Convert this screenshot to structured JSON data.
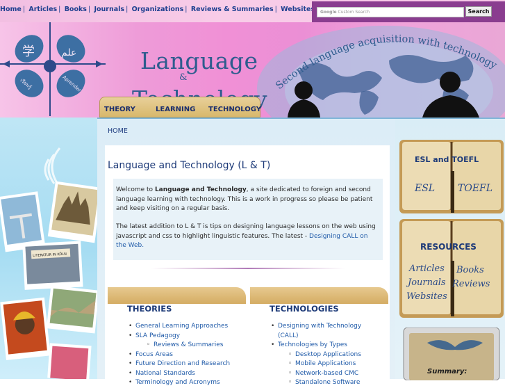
{
  "nav": {
    "links": [
      "Home",
      "Articles",
      "Books",
      "Journals",
      "Organizations",
      "Reviews & Summaries",
      "Websites"
    ]
  },
  "search": {
    "placeholder_brand": "Google",
    "placeholder": "Custom Search",
    "button_label": "Search"
  },
  "header": {
    "title_line1": "Language",
    "title_amp": "&",
    "title_line2": "Technology",
    "tagline": "Second language acquisition with technology",
    "emblem_words": [
      "学",
      "علم",
      "เรียนรู้",
      "Aprender"
    ],
    "tabs": [
      "THEORY",
      "LEARNING",
      "TECHNOLOGY"
    ]
  },
  "collage": {
    "sign_text": "LITERATUR IN KÖLN"
  },
  "main": {
    "breadcrumb": "HOME",
    "page_title": "Language and Technology (L & T)",
    "welcome": {
      "p1_prefix": "Welcome to ",
      "p1_bold": "Language and Technology",
      "p1_rest": ", a site dedicated to foreign and second language learning with technology. This is a work in progress so please be patient and keep visiting on a regular basis.",
      "p2_text": "The latest addition to L & T is tips on designing language lessons on the web using javascript and css to highlight linguistic features. The latest - ",
      "p2_link": "Designing CALL on the Web."
    },
    "theories": {
      "title": "THEORIES",
      "items": [
        {
          "label": "General Learning Approaches",
          "level": 1
        },
        {
          "label": "SLA Pedagogy",
          "level": 1
        },
        {
          "label": "Reviews & Summaries",
          "level": 2
        },
        {
          "label": "Focus Areas",
          "level": 1
        },
        {
          "label": "Future Direction and Research",
          "level": 1
        },
        {
          "label": "National Standards",
          "level": 1
        },
        {
          "label": "Terminology and Acronyms",
          "level": 1
        }
      ]
    },
    "technologies": {
      "title": "TECHNOLOGIES",
      "items": [
        {
          "label": "Designing with Technology (CALL)",
          "level": 1
        },
        {
          "label": "Technologies by Types",
          "level": 1
        },
        {
          "label": "Desktop Applications",
          "level": 2
        },
        {
          "label": "Mobile Applications",
          "level": 2
        },
        {
          "label": "Network-based CMC",
          "level": 2
        },
        {
          "label": "Standalone Software",
          "level": 2
        }
      ]
    }
  },
  "sidebar": {
    "esl_box": {
      "title": "ESL and TOEFL",
      "script_left": "ESL",
      "script_right": "TOEFL"
    },
    "resources_box": {
      "title": "RESOURCES",
      "script_left": [
        "Articles",
        "Journals",
        "Websites"
      ],
      "script_right": [
        "Books",
        "Reviews"
      ]
    },
    "summary_box": {
      "label": "Summary:"
    }
  },
  "colors": {
    "link": "#1f5aa8",
    "heading": "#1d3a78",
    "nav_bg": "#f6c8e6",
    "search_bg": "#8a3d8f",
    "book_tan": "#d4ac63"
  }
}
